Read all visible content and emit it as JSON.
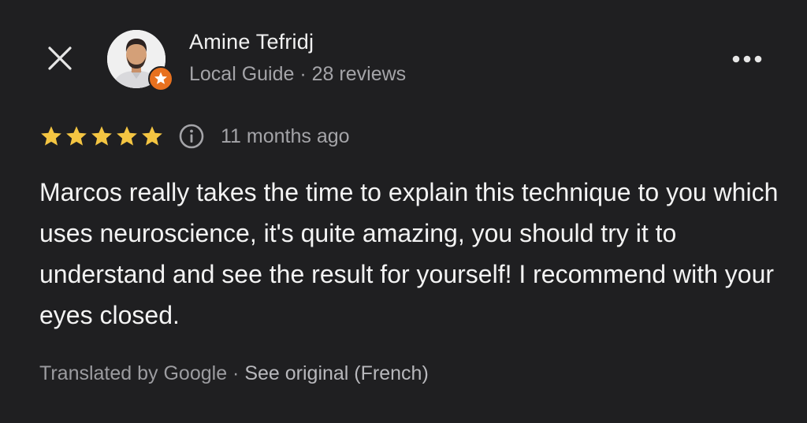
{
  "header": {
    "close_icon": "close-icon",
    "reviewer": {
      "name": "Amine Tefridj",
      "role": "Local Guide",
      "separator": " · ",
      "review_count": "28 reviews",
      "badge_icon": "star-badge-icon",
      "badge_color": "#e8711f"
    },
    "more_icon": "more-horizontal-icon"
  },
  "rating": {
    "stars": 5,
    "max_stars": 5,
    "star_color": "#f4c542",
    "info_icon": "info-icon",
    "time_ago": "11 months ago"
  },
  "review": {
    "text": "Marcos really takes the time to explain this technique to you which uses neuroscience, it's quite amazing, you should try it to understand and see the result for yourself! I recommend with your eyes closed."
  },
  "footer": {
    "translated_by": "Translated by Google",
    "separator": " · ",
    "see_original": "See original (French)"
  },
  "colors": {
    "background": "#1f1f21",
    "primary_text": "#f3f3f3",
    "secondary_text": "#a4a4a8"
  }
}
